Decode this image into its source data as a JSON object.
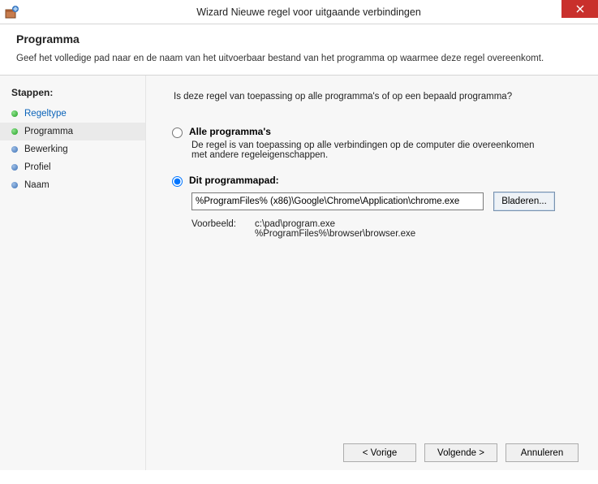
{
  "titlebar": {
    "title": "Wizard Nieuwe regel voor uitgaande verbindingen"
  },
  "header": {
    "heading": "Programma",
    "subtext": "Geef het volledige pad naar en de naam van het uitvoerbaar bestand van het programma op waarmee deze regel overeenkomt."
  },
  "sidebar": {
    "title": "Stappen:",
    "items": [
      {
        "label": "Regeltype"
      },
      {
        "label": "Programma"
      },
      {
        "label": "Bewerking"
      },
      {
        "label": "Profiel"
      },
      {
        "label": "Naam"
      }
    ]
  },
  "main": {
    "question": "Is deze regel van toepassing op alle programma's of op een bepaald programma?",
    "opt_all": {
      "label": "Alle programma's",
      "desc": "De regel is van toepassing op alle verbindingen op de computer die overeenkomen met andere regeleigenschappen."
    },
    "opt_path": {
      "label": "Dit programmapad:",
      "value": "%ProgramFiles% (x86)\\Google\\Chrome\\Application\\chrome.exe",
      "browse": "Bladeren..."
    },
    "example": {
      "label": "Voorbeeld:",
      "value": "c:\\pad\\program.exe\n%ProgramFiles%\\browser\\browser.exe"
    }
  },
  "footer": {
    "back": "< Vorige",
    "next": "Volgende >",
    "cancel": "Annuleren"
  }
}
